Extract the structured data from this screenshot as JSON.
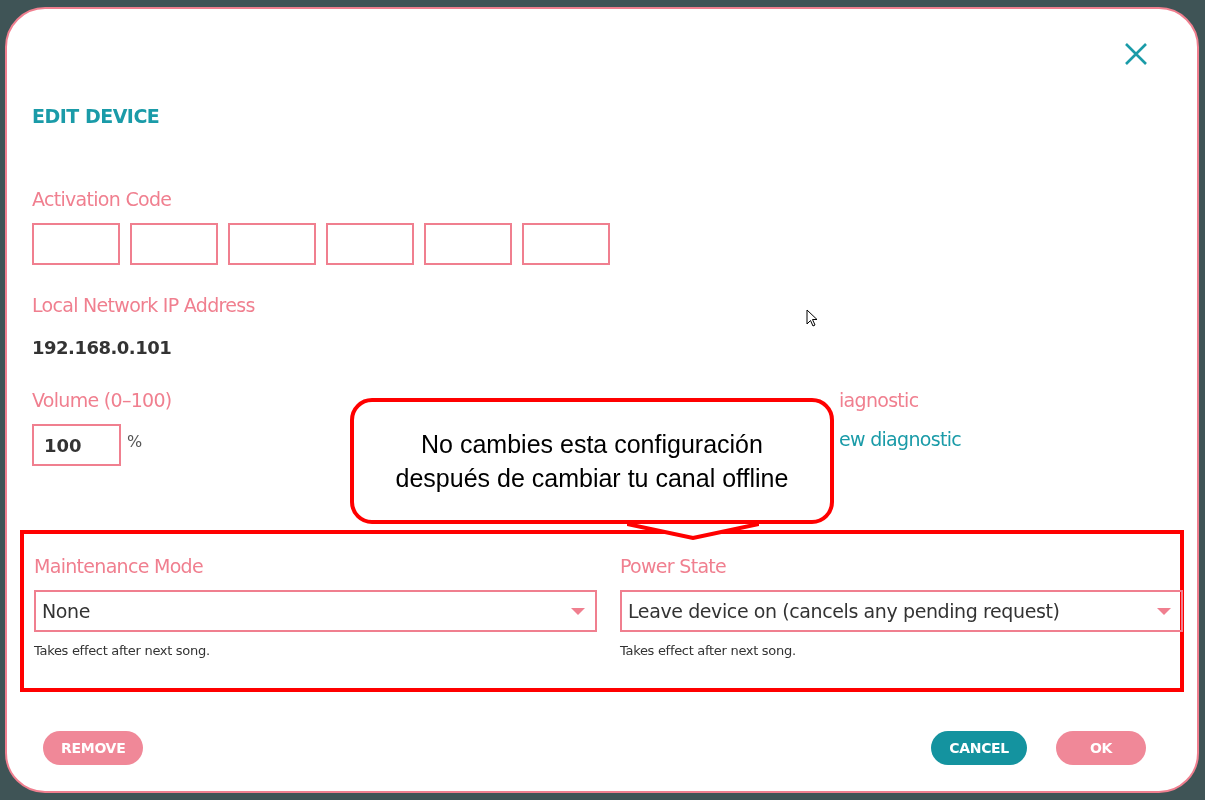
{
  "dialog": {
    "title": "EDIT DEVICE",
    "activation": {
      "label": "Activation Code"
    },
    "ip": {
      "label": "Local Network IP Address",
      "value": "192.168.0.101"
    },
    "volume": {
      "label": "Volume (0–100)",
      "value": "100",
      "unit": "%"
    },
    "diagnostic": {
      "label": "iagnostic",
      "link": "ew diagnostic"
    },
    "settings": {
      "highlighted": true,
      "fields": [
        {
          "label": "Maintenance Mode",
          "value": "None",
          "hint": "Takes effect after next song."
        },
        {
          "label": "Power State",
          "value": "Leave device on (cancels any pending request)",
          "hint": "Takes effect after next song."
        }
      ]
    },
    "buttons": [
      {
        "label": "REMOVE",
        "kind": "light"
      },
      {
        "label": "CANCEL",
        "kind": "accent"
      },
      {
        "label": "OK",
        "kind": "light"
      }
    ]
  },
  "annotation": {
    "text": "No cambies esta configuración\ndespués de cambiar tu canal offline"
  }
}
